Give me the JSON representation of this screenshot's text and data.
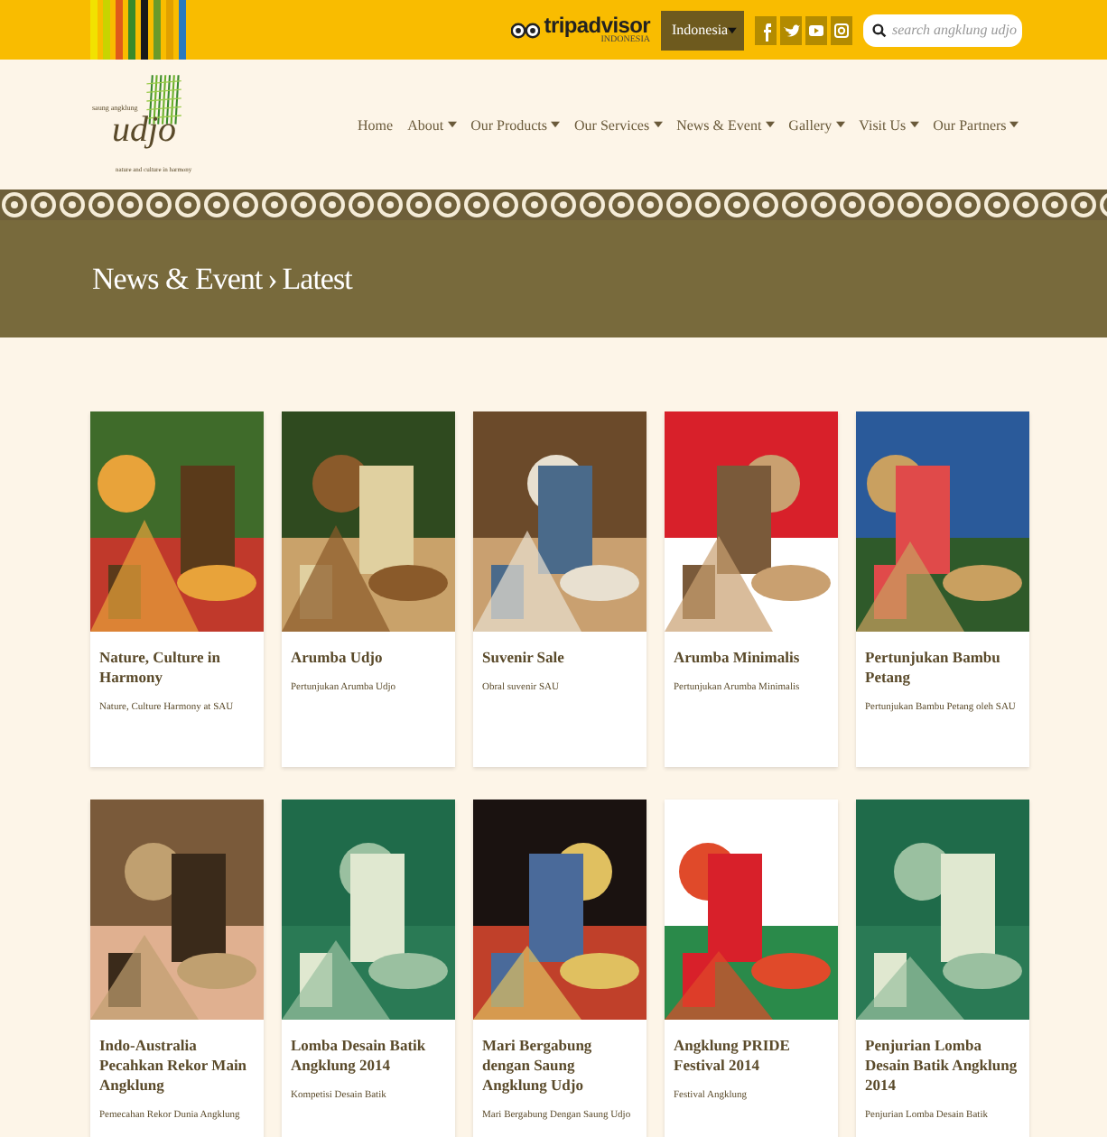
{
  "topbar": {
    "tripadvisor": {
      "name": "tripadvisor",
      "region": "INDONESIA"
    },
    "language": "Indonesia",
    "search": {
      "placeholder": "search angklung udjo"
    }
  },
  "logo": {
    "tagline_top": "saung angklung",
    "wordmark": "udjo",
    "tagline_bottom": "nature and culture in harmony"
  },
  "nav": [
    {
      "label": "Home",
      "has_menu": false
    },
    {
      "label": "About",
      "has_menu": true
    },
    {
      "label": "Our Products",
      "has_menu": true
    },
    {
      "label": "Our Services",
      "has_menu": true
    },
    {
      "label": "News & Event",
      "has_menu": true
    },
    {
      "label": "Gallery",
      "has_menu": true
    },
    {
      "label": "Visit Us",
      "has_menu": true
    },
    {
      "label": "Our Partners",
      "has_menu": true
    }
  ],
  "breadcrumb": {
    "items": [
      "News & Event",
      "Latest"
    ],
    "separator": "›"
  },
  "posts": [
    {
      "title": "Nature, Culture in Harmony",
      "summary": "Nature, Culture Harmony at SAU"
    },
    {
      "title": "Arumba Udjo",
      "summary": "Pertunjukan Arumba Udjo"
    },
    {
      "title": "Suvenir Sale",
      "summary": "Obral suvenir SAU"
    },
    {
      "title": "Arumba Minimalis",
      "summary": "Pertunjukan Arumba Minimalis"
    },
    {
      "title": "Pertunjukan Bambu Petang",
      "summary": "Pertunjukan Bambu Petang oleh SAU"
    },
    {
      "title": "Indo-Australia Pecahkan Rekor Main Angklung",
      "summary": "Pemecahan Rekor Dunia Angklung"
    },
    {
      "title": "Lomba Desain Batik Angklung 2014",
      "summary": "Kompetisi Desain Batik"
    },
    {
      "title": "Mari Bergabung dengan Saung Angklung Udjo",
      "summary": "Mari Bergabung Dengan Saung Udjo"
    },
    {
      "title": "Angklung PRIDE Festival 2014",
      "summary": "Festival Angklung"
    },
    {
      "title": "Penjurian Lomba Desain Batik Angklung 2014",
      "summary": "Penjurian Lomba Desain Batik"
    }
  ]
}
